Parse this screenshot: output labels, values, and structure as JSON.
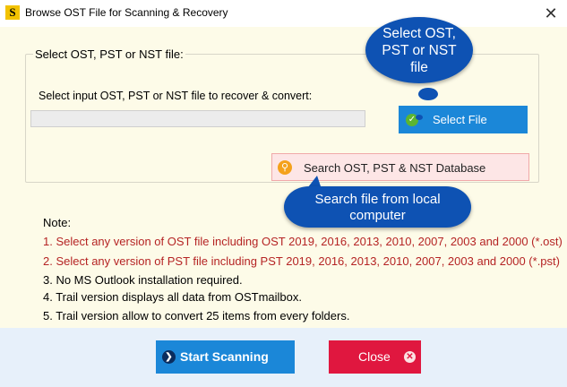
{
  "window": {
    "title": "Browse OST File for Scanning & Recovery",
    "app_icon_letter": "S",
    "close_glyph": "✕"
  },
  "group": {
    "legend": "Select OST, PST or NST file:",
    "input_label": "Select input OST, PST or NST file to recover & convert:",
    "path_value": ""
  },
  "buttons": {
    "select_file": "Select File",
    "search_db": "Search OST, PST & NST Database",
    "start": "Start Scanning",
    "close": "Close"
  },
  "bubbles": {
    "select_line1": "Select OST,",
    "select_line2": "PST or NST",
    "select_line3": "file",
    "search_line1": "Search file from local",
    "search_line2": "computer"
  },
  "notes": {
    "heading": "Note:",
    "items": [
      "1. Select any version of OST file including OST 2019, 2016, 2013, 2010, 2007, 2003 and 2000 (*.ost)",
      "2. Select any version of PST file including PST 2019, 2016, 2013, 2010, 2007, 2003 and 2000 (*.pst)",
      "3. No MS Outlook installation required.",
      "4. Trail version displays all data from OSTmailbox.",
      "5. Trail version allow to convert 25 items from every folders."
    ]
  },
  "icons": {
    "app": "app-logo-icon",
    "check": "check-icon",
    "search": "search-icon",
    "arrow": "arrow-right-icon",
    "close": "close-icon"
  },
  "colors": {
    "accent_blue": "#1b87d8",
    "bubble_blue": "#0e52b3",
    "close_red": "#e0173f",
    "note_red": "#b52424"
  }
}
